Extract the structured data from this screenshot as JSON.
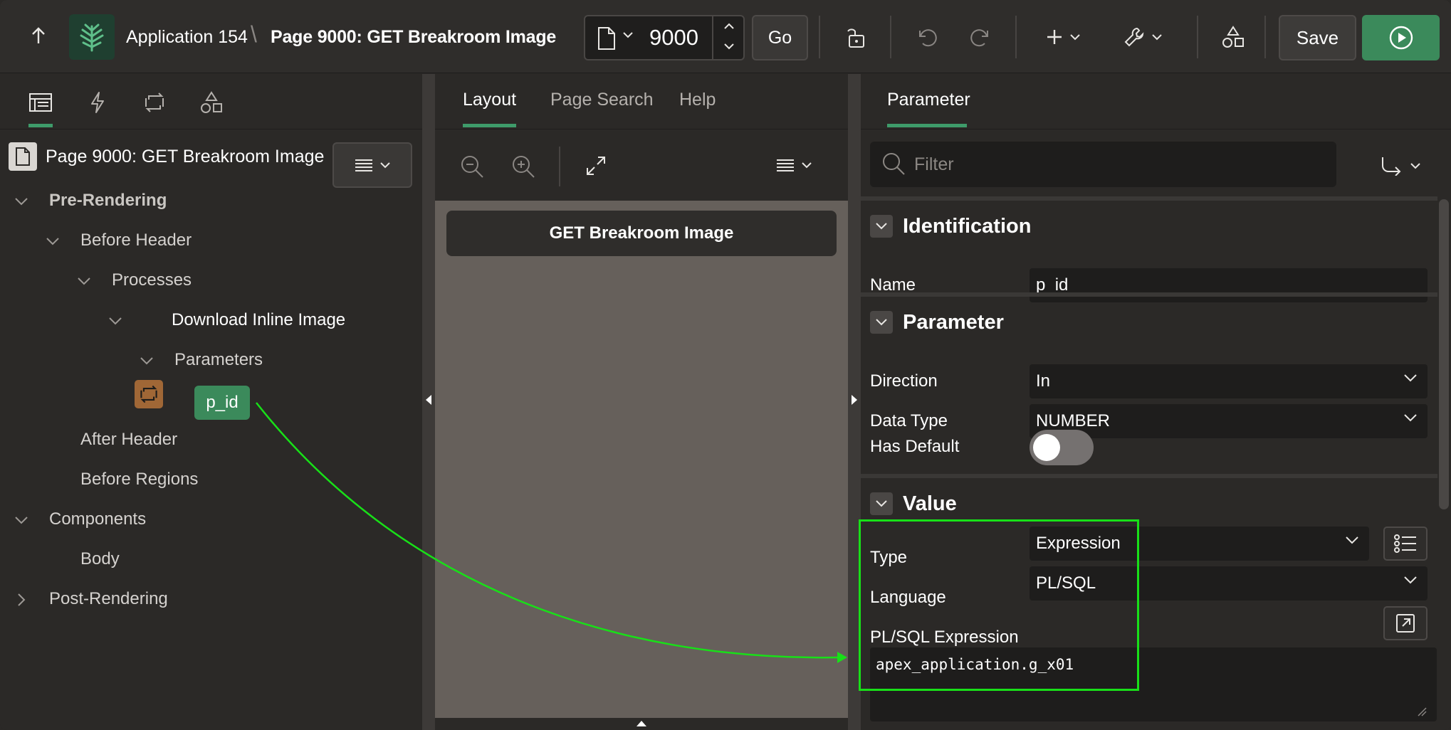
{
  "header": {
    "app_title": "Application 154",
    "separator": "\\",
    "page_title": "Page 9000: GET Breakroom Image",
    "page_number": "9000",
    "go_label": "Go",
    "save_label": "Save"
  },
  "left_panel": {
    "root_label": "Page 9000: GET Breakroom Image",
    "tree": {
      "pre_rendering": "Pre-Rendering",
      "before_header": "Before Header",
      "processes": "Processes",
      "download_inline_image": "Download Inline Image",
      "parameters": "Parameters",
      "p_id": "p_id",
      "after_header": "After Header",
      "before_regions": "Before Regions",
      "components": "Components",
      "body": "Body",
      "post_rendering": "Post-Rendering"
    }
  },
  "middle_panel": {
    "tabs": [
      "Layout",
      "Page Search",
      "Help"
    ],
    "region_title": "GET Breakroom Image"
  },
  "right_panel": {
    "tab_label": "Parameter",
    "filter_placeholder": "Filter",
    "sections": {
      "identification": "Identification",
      "parameter": "Parameter",
      "value": "Value"
    },
    "fields": {
      "name_label": "Name",
      "name_value": "p_id",
      "direction_label": "Direction",
      "direction_value": "In",
      "data_type_label": "Data Type",
      "data_type_value": "NUMBER",
      "has_default_label": "Has Default",
      "type_label": "Type",
      "type_value": "Expression",
      "language_label": "Language",
      "language_value": "PL/SQL",
      "expression_label": "PL/SQL Expression",
      "expression_value": "apex_application.g_x01"
    }
  },
  "colors": {
    "accent_green": "#3b8a5b",
    "annotation_green": "#18e018",
    "process_icon": "#a06736"
  }
}
